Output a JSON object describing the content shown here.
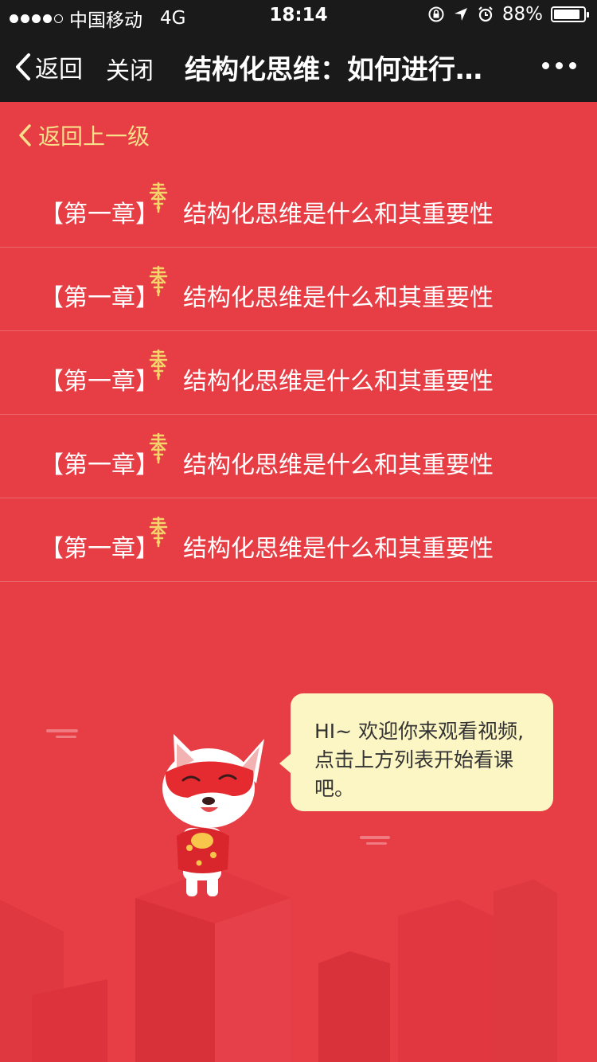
{
  "status_bar": {
    "carrier": "中国移动",
    "network": "4G",
    "time": "18:14",
    "battery": "88%",
    "battery_level": 0.88
  },
  "navbar": {
    "back_label": "返回",
    "close_label": "关闭",
    "title": "结构化思维：如何进行…"
  },
  "uplevel_label": "返回上一级",
  "chapters": [
    {
      "tag": "【第一章】",
      "title": "结构化思维是什么和其重要性"
    },
    {
      "tag": "【第一章】",
      "title": "结构化思维是什么和其重要性"
    },
    {
      "tag": "【第一章】",
      "title": "结构化思维是什么和其重要性"
    },
    {
      "tag": "【第一章】",
      "title": "结构化思维是什么和其重要性"
    },
    {
      "tag": "【第一章】",
      "title": "结构化思维是什么和其重要性"
    }
  ],
  "bubble": {
    "line1": "HI~ 欢迎你来观看视频,",
    "line2": "点击上方列表开始看课",
    "line3": "吧。"
  },
  "colors": {
    "background": "#e73d45",
    "navbar": "#1a1a1a",
    "accent_gold": "#f7df8b",
    "bubble": "#fcf5c4"
  },
  "icons": [
    "back-chevron-icon",
    "more-dots-icon",
    "spring-icon",
    "mascot-dog-illustration"
  ]
}
